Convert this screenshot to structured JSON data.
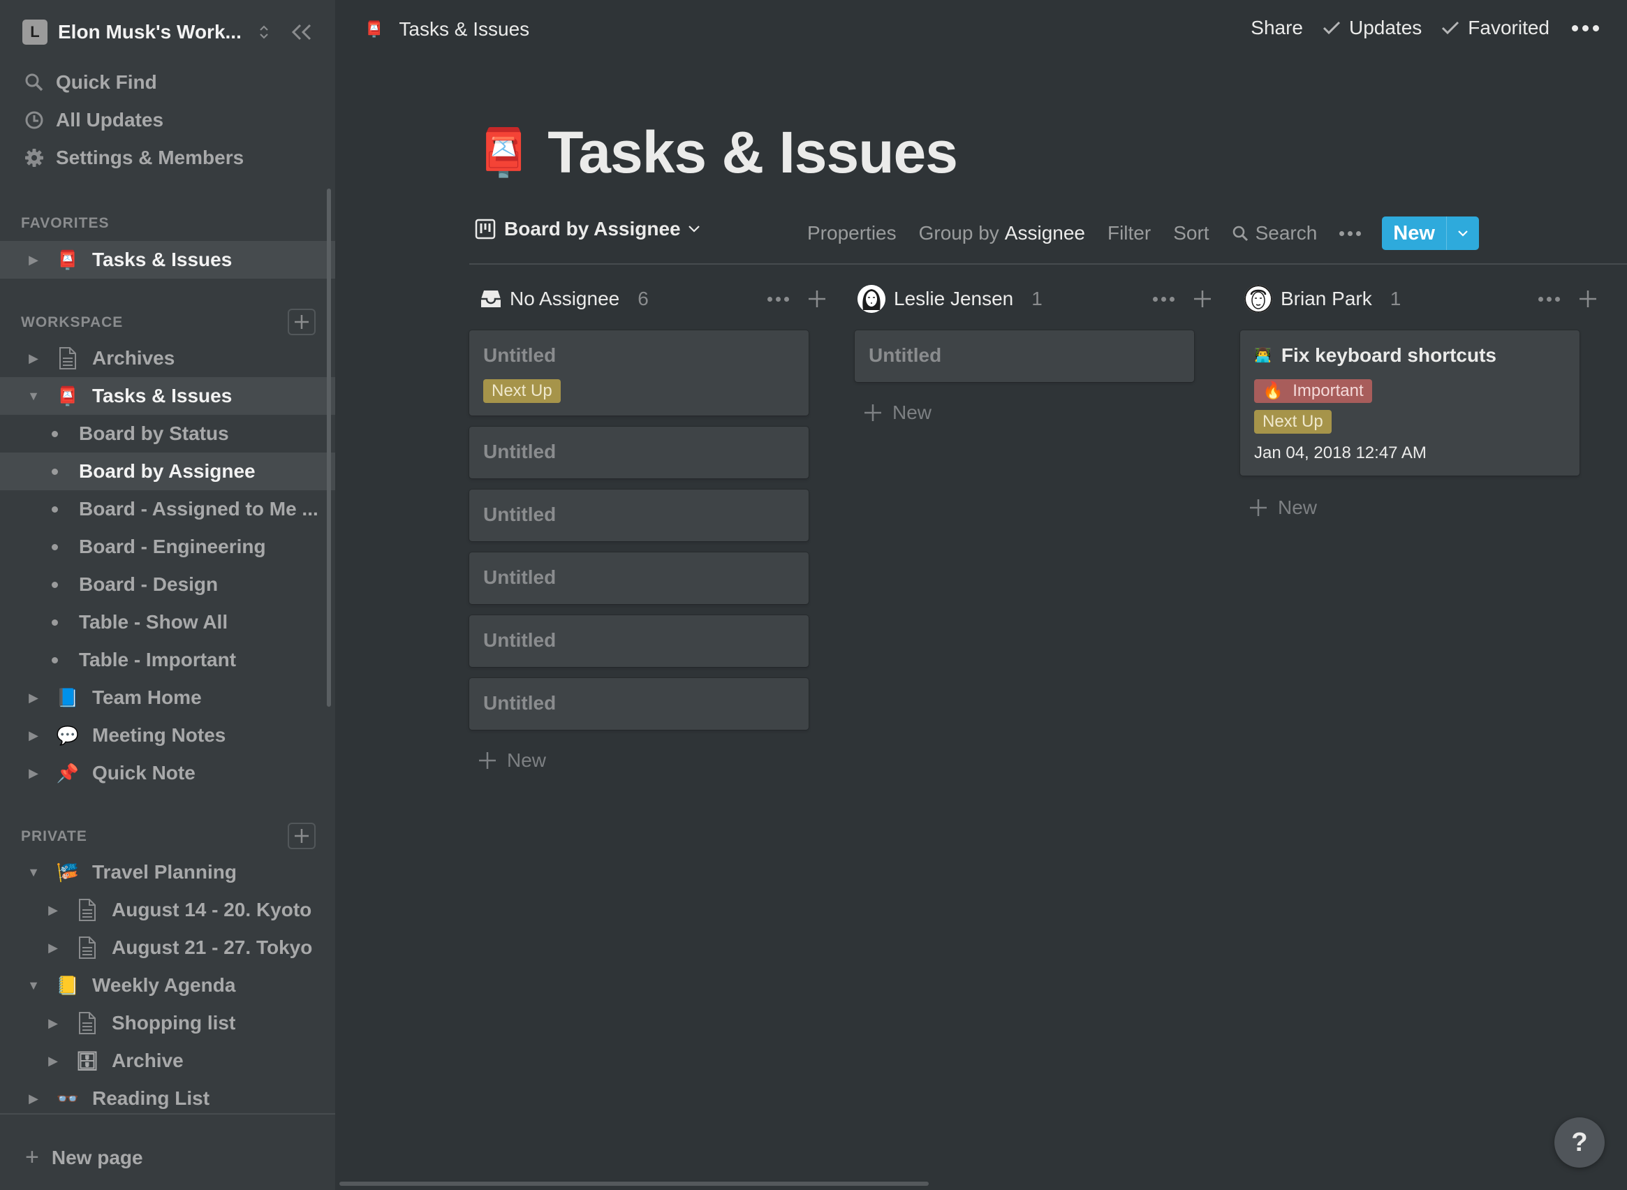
{
  "workspace": {
    "initial": "L",
    "name": "Elon Musk's Work..."
  },
  "sidebar": {
    "top_items": [
      {
        "label": "Quick Find",
        "icon": "search-icon"
      },
      {
        "label": "All Updates",
        "icon": "clock-icon"
      },
      {
        "label": "Settings & Members",
        "icon": "gear-icon"
      }
    ],
    "favorites_label": "FAVORITES",
    "favorites": [
      {
        "label": "Tasks & Issues",
        "emoji": "📮",
        "expanded": false,
        "selected": true
      }
    ],
    "workspace_label": "WORKSPACE",
    "workspace_items": [
      {
        "label": "Archives",
        "emoji": "doc",
        "expanded": false
      },
      {
        "label": "Tasks & Issues",
        "emoji": "📮",
        "expanded": true,
        "selected": true,
        "children": [
          {
            "label": "Board by Status"
          },
          {
            "label": "Board by Assignee",
            "active": true
          },
          {
            "label": "Board - Assigned to Me ..."
          },
          {
            "label": "Board - Engineering"
          },
          {
            "label": "Board - Design"
          },
          {
            "label": "Table - Show All"
          },
          {
            "label": "Table - Important"
          }
        ]
      },
      {
        "label": "Team Home",
        "emoji": "📘",
        "expanded": false
      },
      {
        "label": "Meeting Notes",
        "emoji": "💬",
        "expanded": false
      },
      {
        "label": "Quick Note",
        "emoji": "📌",
        "expanded": false
      }
    ],
    "private_label": "PRIVATE",
    "private_items": [
      {
        "label": "Travel Planning",
        "emoji": "🎏",
        "expanded": true,
        "children": [
          {
            "label": "August 14 - 20. Kyoto",
            "emoji": "doc"
          },
          {
            "label": "August 21 - 27. Tokyo",
            "emoji": "doc"
          }
        ]
      },
      {
        "label": "Weekly Agenda",
        "emoji": "📒",
        "expanded": true,
        "children": [
          {
            "label": "Shopping list",
            "emoji": "doc"
          },
          {
            "label": "Archive",
            "emoji": "🗄"
          }
        ]
      },
      {
        "label": "Reading List",
        "emoji": "👓",
        "expanded": false
      }
    ],
    "new_page_label": "New page"
  },
  "topbar": {
    "breadcrumb_emoji": "📮",
    "breadcrumb": "Tasks & Issues",
    "share": "Share",
    "updates": "Updates",
    "favorited": "Favorited"
  },
  "page": {
    "emoji": "📮",
    "title": "Tasks & Issues"
  },
  "view": {
    "name": "Board by Assignee",
    "properties": "Properties",
    "group_by_prefix": "Group by",
    "group_by_value": "Assignee",
    "filter": "Filter",
    "sort": "Sort",
    "search": "Search",
    "new": "New",
    "accent": "#2eaadc"
  },
  "board": {
    "add_new_label": "New",
    "columns": [
      {
        "name": "No Assignee",
        "count": "6",
        "avatar": "inbox-icon",
        "cards": [
          {
            "title": "Untitled",
            "placeholder": true,
            "tags": [
              {
                "label": "Next Up",
                "color": "yellow"
              }
            ]
          },
          {
            "title": "Untitled",
            "placeholder": true,
            "tags": []
          },
          {
            "title": "Untitled",
            "placeholder": true,
            "tags": []
          },
          {
            "title": "Untitled",
            "placeholder": true,
            "tags": []
          },
          {
            "title": "Untitled",
            "placeholder": true,
            "tags": []
          },
          {
            "title": "Untitled",
            "placeholder": true,
            "tags": []
          }
        ]
      },
      {
        "name": "Leslie Jensen",
        "count": "1",
        "avatar": "leslie-avatar",
        "cards": [
          {
            "title": "Untitled",
            "placeholder": true,
            "tags": []
          }
        ]
      },
      {
        "name": "Brian Park",
        "count": "1",
        "avatar": "brian-avatar",
        "cards": [
          {
            "title": "Fix keyboard shortcuts",
            "emoji": "👨‍💻",
            "placeholder": false,
            "tags": [
              {
                "label": "Important",
                "emoji": "🔥",
                "color": "red"
              },
              {
                "label": "Next Up",
                "color": "yellow"
              }
            ],
            "date": "Jan 04, 2018 12:47 AM"
          }
        ]
      }
    ]
  },
  "help_label": "?"
}
